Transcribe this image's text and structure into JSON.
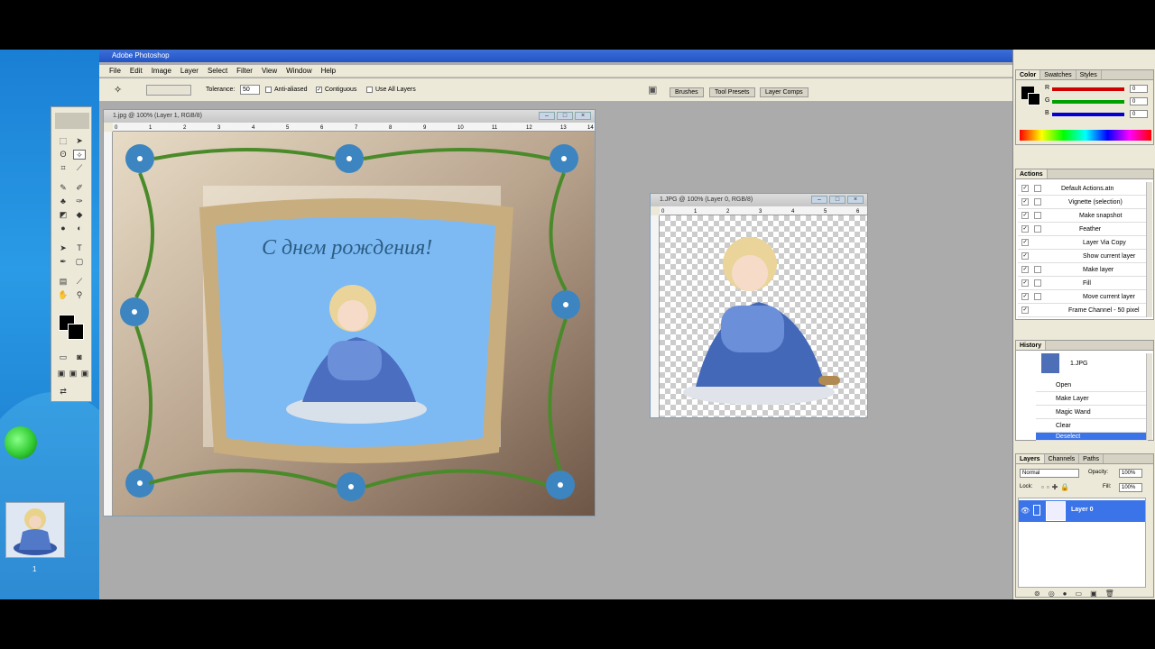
{
  "desktop": {
    "thumb_label": "1"
  },
  "app": {
    "title": "Adobe Photoshop"
  },
  "menu": [
    "File",
    "Edit",
    "Image",
    "Layer",
    "Select",
    "Filter",
    "View",
    "Window",
    "Help"
  ],
  "options": {
    "tolerance_label": "Tolerance:",
    "tolerance_value": "50",
    "anti_aliased": "Anti-aliased",
    "contiguous": "Contiguous",
    "use_all_layers": "Use All Layers"
  },
  "dock_tabs": [
    "Brushes",
    "Tool Presets",
    "Layer Comps"
  ],
  "doc1": {
    "title": "1.jpg @ 100% (Layer 1, RGB/8)",
    "ruler": [
      "0",
      "1",
      "2",
      "3",
      "4",
      "5",
      "6",
      "7",
      "8",
      "9",
      "10",
      "11",
      "12",
      "13",
      "14"
    ],
    "greeting": "С днем рождения!"
  },
  "doc2": {
    "title": "1.JPG @ 100% (Layer 0, RGB/8)",
    "ruler": [
      "0",
      "1",
      "2",
      "3",
      "4",
      "5",
      "6"
    ]
  },
  "color_panel": {
    "tabs": [
      "Color",
      "Swatches",
      "Styles"
    ],
    "channels": [
      {
        "label": "R",
        "value": "0",
        "color": "#d00000"
      },
      {
        "label": "G",
        "value": "0",
        "color": "#00a000"
      },
      {
        "label": "B",
        "value": "0",
        "color": "#0000d0"
      }
    ]
  },
  "actions_panel": {
    "title": "Actions",
    "items": [
      "Default Actions.atn",
      "Vignette (selection)",
      "Make snapshot",
      "Feather",
      "Layer Via Copy",
      "Show current layer",
      "Make layer",
      "Fill",
      "Move current layer",
      "Frame Channel - 50 pixel"
    ]
  },
  "history_panel": {
    "title": "History",
    "snapshot": "1.JPG",
    "items": [
      "Open",
      "Make Layer",
      "Magic Wand",
      "Clear",
      "Deselect"
    ]
  },
  "layers_panel": {
    "tabs": [
      "Layers",
      "Channels",
      "Paths"
    ],
    "blend_mode": "Normal",
    "opacity_label": "Opacity:",
    "opacity_value": "100%",
    "lock_label": "Lock:",
    "fill_label": "Fill:",
    "fill_value": "100%",
    "layer_name": "Layer 0"
  },
  "colors": {
    "selection": "#3b74e8",
    "photoshop_bg": "#ababab"
  }
}
